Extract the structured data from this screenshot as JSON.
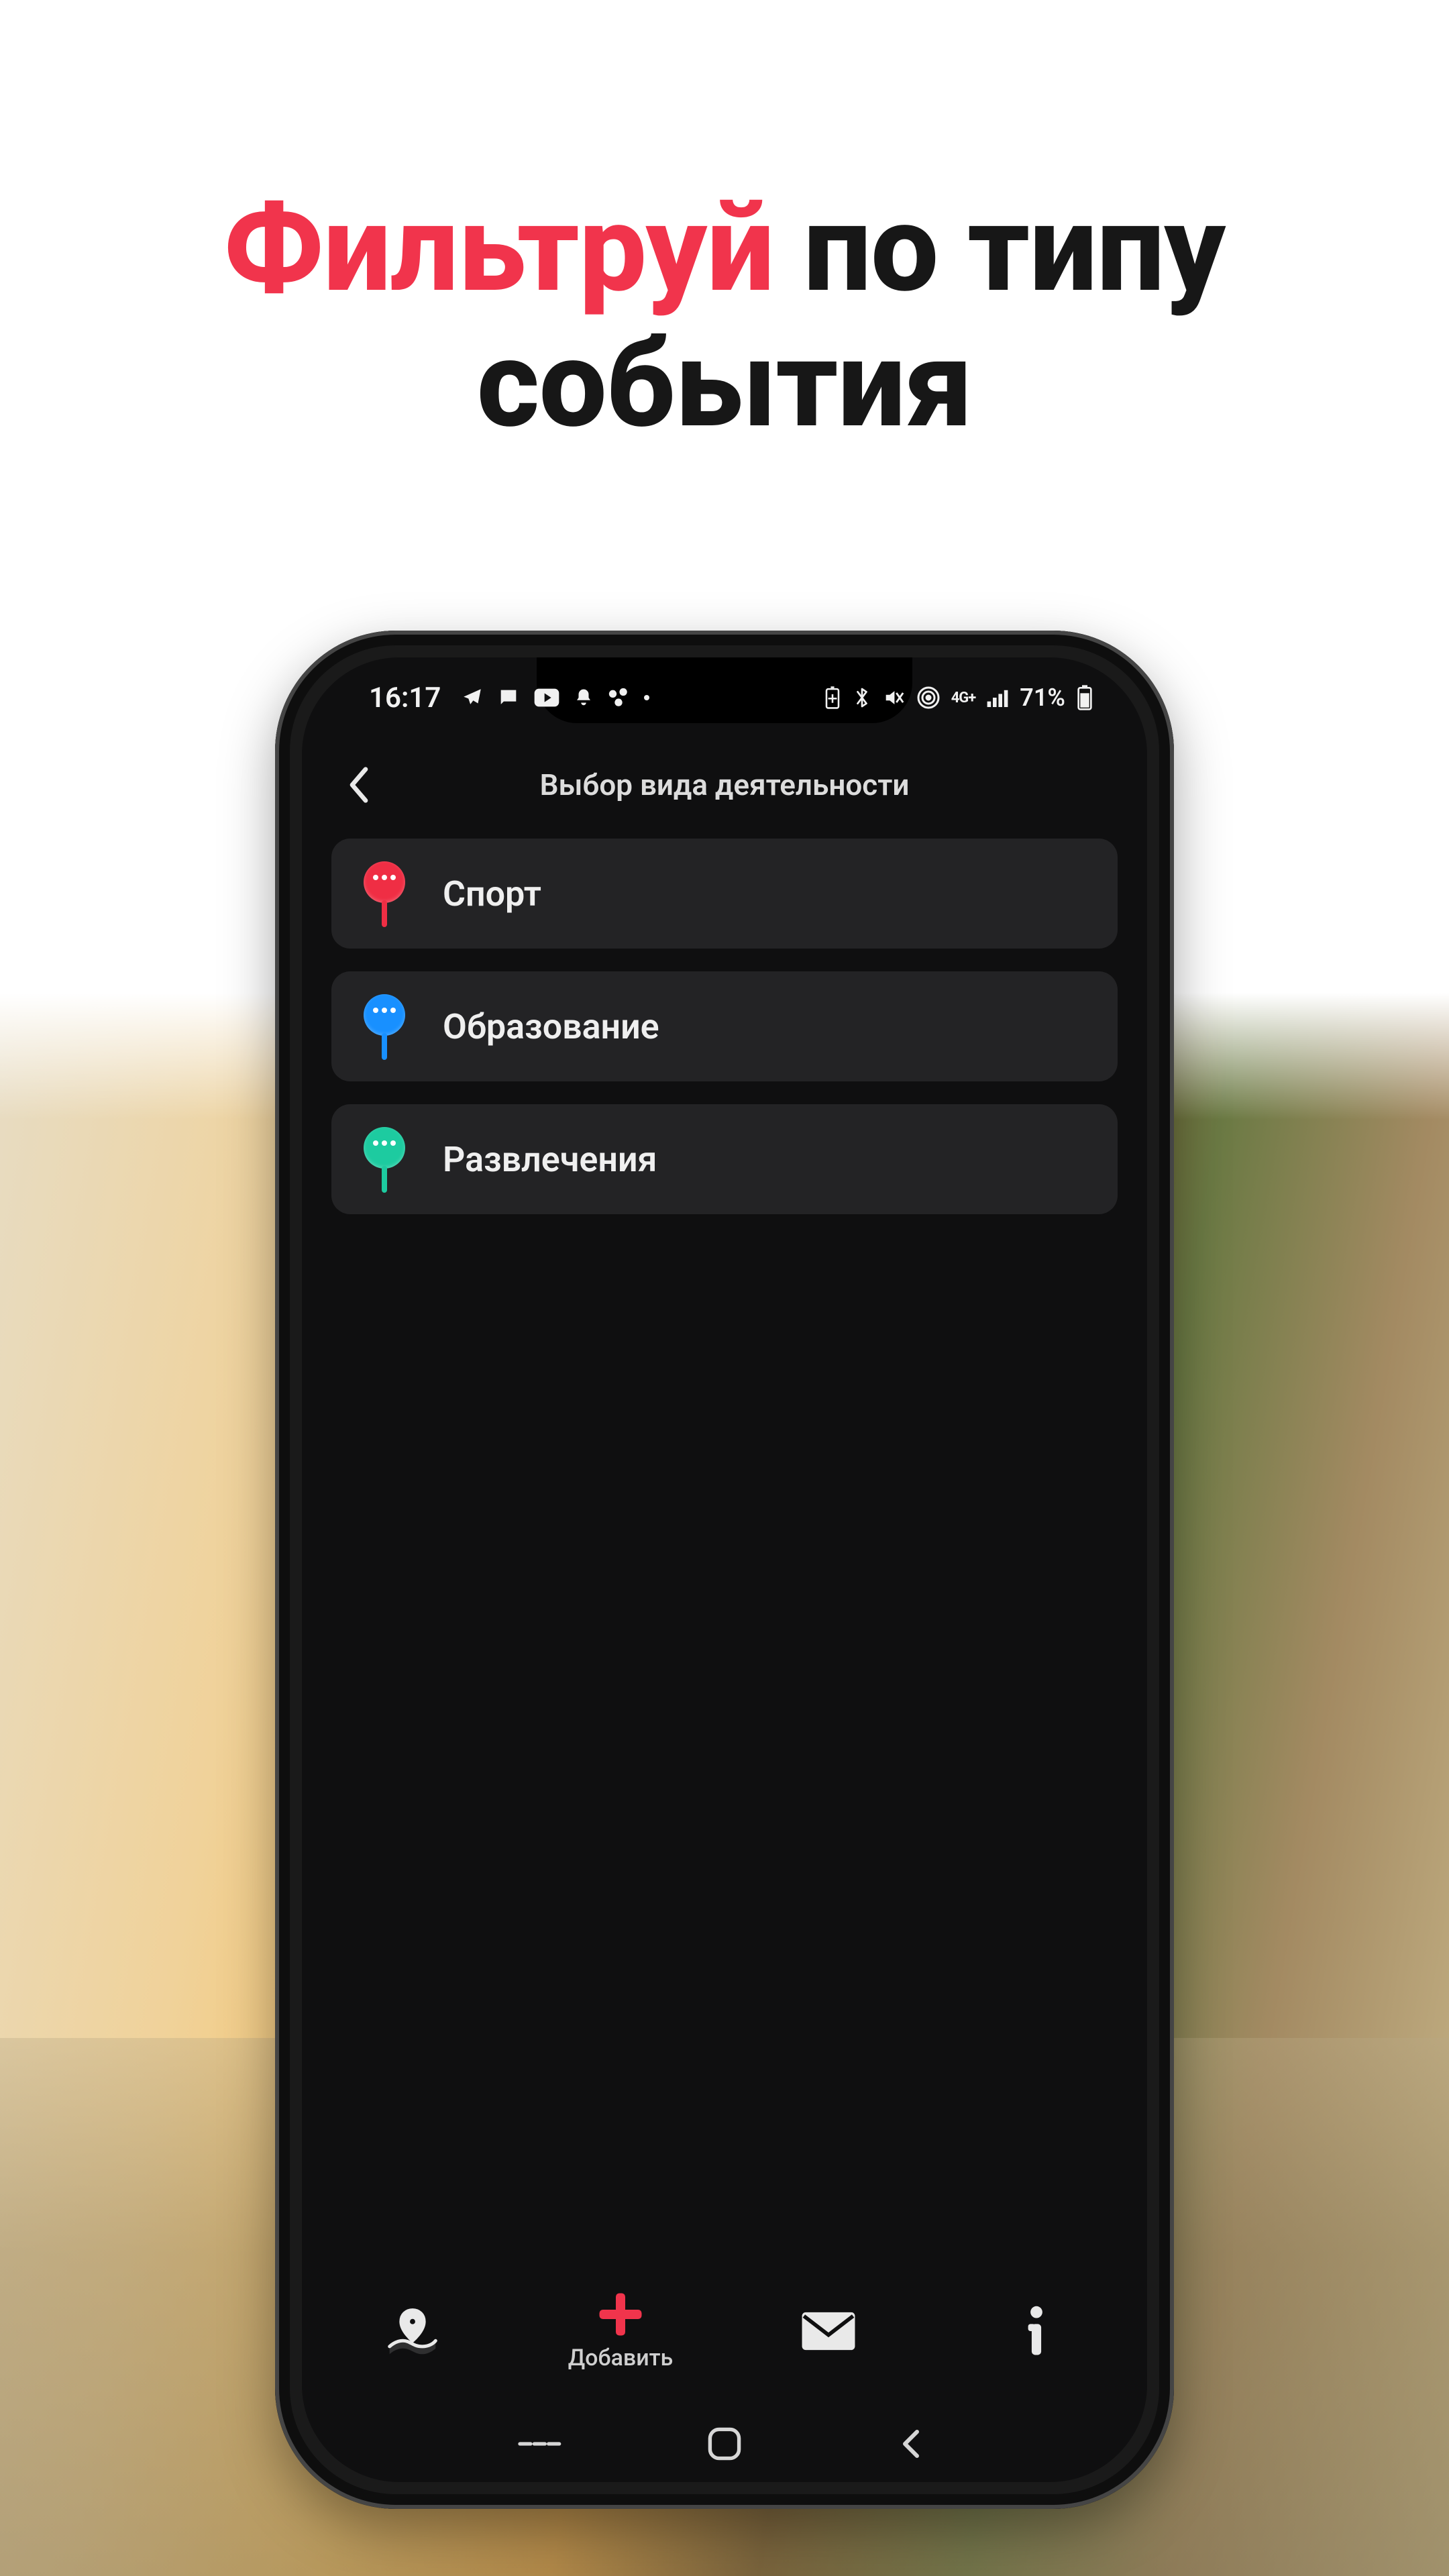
{
  "hero": {
    "accent_word": "Фильтруй",
    "rest_line1": " по типу",
    "line2": "события",
    "accent_color": "#f1344c"
  },
  "statusbar": {
    "time": "16:17",
    "battery_text": "71%"
  },
  "header": {
    "title": "Выбор вида деятельности"
  },
  "categories": [
    {
      "label": "Спорт",
      "color": "#ef2e44"
    },
    {
      "label": "Образование",
      "color": "#1890ff"
    },
    {
      "label": "Развлечения",
      "color": "#1dcba0"
    }
  ],
  "bottom_nav": {
    "add_label": "Добавить",
    "accent": "#f1344c"
  }
}
